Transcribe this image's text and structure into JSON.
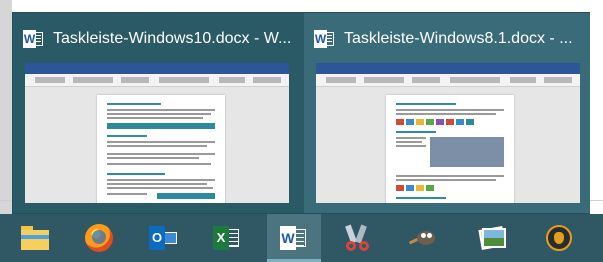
{
  "popup": {
    "thumbnails": [
      {
        "title": "Taskleiste-Windows10.docx - W...",
        "icon": "word-icon"
      },
      {
        "title": "Taskleiste-Windows8.1.docx - ...",
        "icon": "word-icon"
      }
    ]
  },
  "taskbar": {
    "items": [
      {
        "name": "File Explorer",
        "icon": "folder-icon"
      },
      {
        "name": "Firefox",
        "icon": "firefox-icon"
      },
      {
        "name": "Outlook",
        "icon": "outlook-icon"
      },
      {
        "name": "Excel",
        "icon": "excel-icon"
      },
      {
        "name": "Word",
        "icon": "word-icon",
        "active": true
      },
      {
        "name": "Snipping Tool",
        "icon": "scissors-icon"
      },
      {
        "name": "GIMP",
        "icon": "gimp-icon"
      },
      {
        "name": "Photos",
        "icon": "photos-icon"
      },
      {
        "name": "Media player",
        "icon": "media-icon"
      }
    ]
  },
  "colors": {
    "taskbar": "#2f5764",
    "popup": "#2a5a66",
    "active_thumb": "#3a6b78",
    "word_blue": "#2b579a"
  }
}
